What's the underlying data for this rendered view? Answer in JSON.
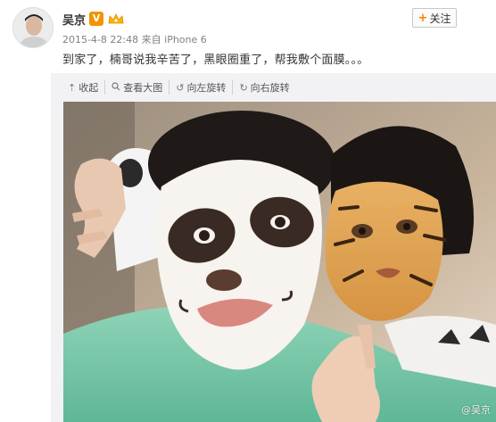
{
  "post": {
    "username": "吴京",
    "verified_badge": "V",
    "timestamp": "2015-4-8 22:48",
    "source_prefix": "来自",
    "source": "iPhone 6",
    "content": "到家了，楠哥说我辛苦了，黑眼圈重了，帮我敷个面膜。。。"
  },
  "follow": {
    "plus": "+",
    "label": "关注"
  },
  "toolbar": {
    "collapse": "收起",
    "view_large": "查看大图",
    "rotate_left": "向左旋转",
    "rotate_right": "向右旋转"
  },
  "photo": {
    "watermark": "@吴京"
  },
  "colors": {
    "accent": "#ff8200",
    "verified": "#f29400",
    "media_bg": "#f2f2f5"
  }
}
